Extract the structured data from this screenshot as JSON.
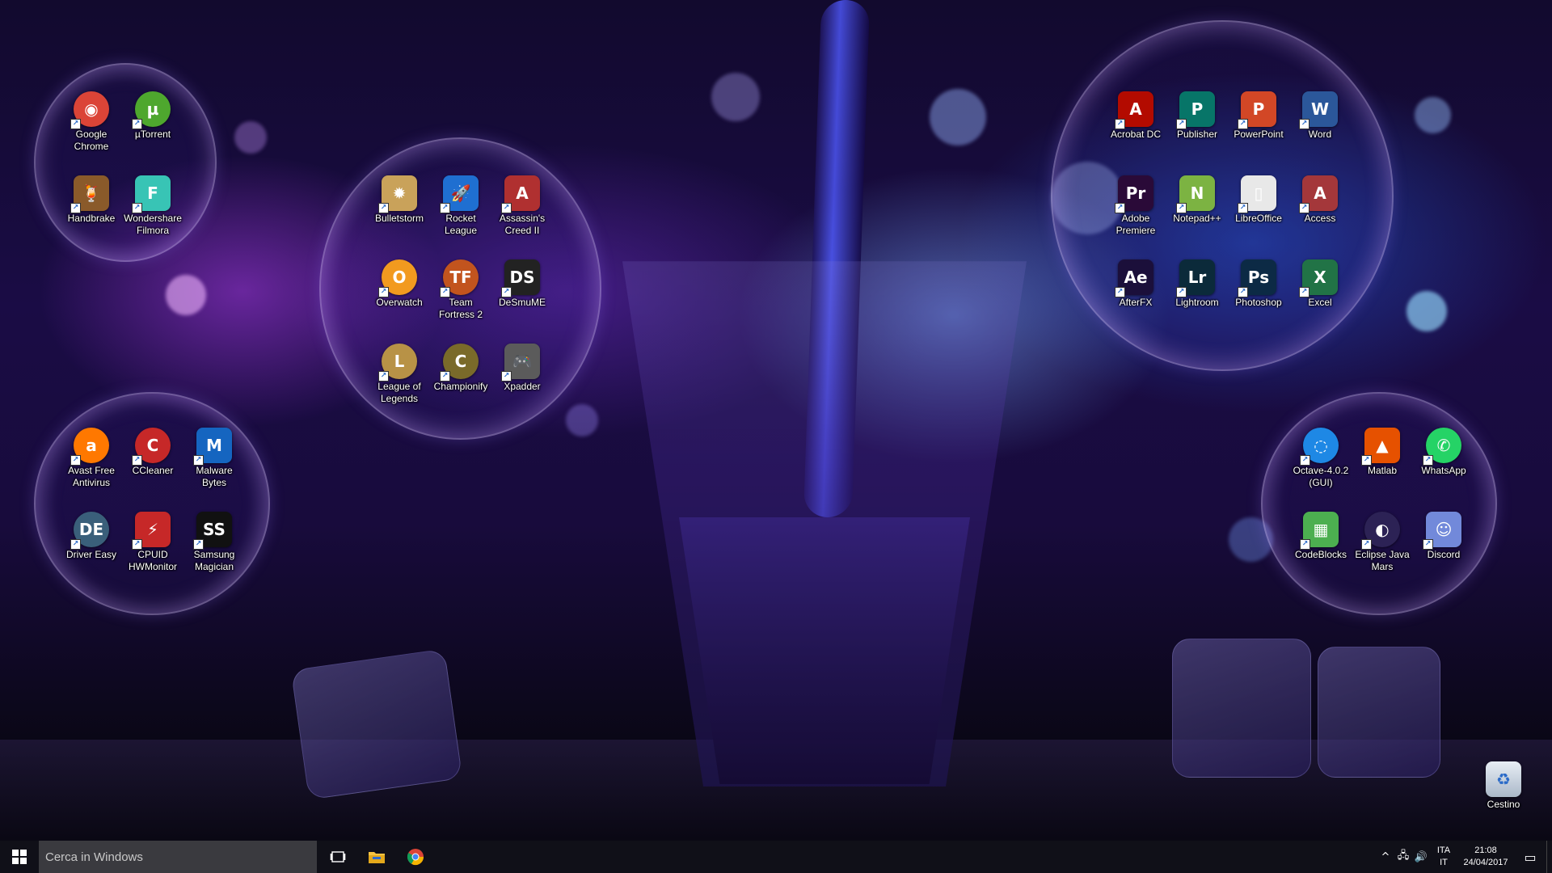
{
  "desktop": {
    "groups": [
      {
        "name": "group-browsers",
        "icons": [
          {
            "label": "Google\nChrome",
            "icon": "chrome-icon",
            "glyph": "◉",
            "color": "#db4437",
            "round": true
          },
          {
            "label": "µTorrent",
            "icon": "utorrent-icon",
            "glyph": "µ",
            "color": "#4ea72e",
            "round": true
          },
          {
            "label": "Handbrake",
            "icon": "handbrake-icon",
            "glyph": "🍹",
            "color": "#8a5a2a",
            "round": false
          },
          {
            "label": "Wondershare\nFilmora",
            "icon": "filmora-icon",
            "glyph": "F",
            "color": "#38c4b5",
            "round": false
          }
        ]
      },
      {
        "name": "group-games",
        "icons": [
          {
            "label": "Bulletstorm",
            "icon": "bulletstorm-icon",
            "glyph": "✹",
            "color": "#c9a25a",
            "round": false
          },
          {
            "label": "Rocket\nLeague",
            "icon": "rocket-league-icon",
            "glyph": "🚀",
            "color": "#1f6fd1",
            "round": false
          },
          {
            "label": "Assassin's\nCreed II",
            "icon": "assassins-creed-icon",
            "glyph": "A",
            "color": "#b03030",
            "round": false
          },
          {
            "label": "Overwatch",
            "icon": "overwatch-icon",
            "glyph": "O",
            "color": "#f29a1f",
            "round": true
          },
          {
            "label": "Team\nFortress 2",
            "icon": "tf2-icon",
            "glyph": "TF",
            "color": "#c2541e",
            "round": true
          },
          {
            "label": "DeSmuME",
            "icon": "desmume-icon",
            "glyph": "DS",
            "color": "#222222",
            "round": false
          },
          {
            "label": "League of\nLegends",
            "icon": "league-of-legends-icon",
            "glyph": "L",
            "color": "#b89246",
            "round": true
          },
          {
            "label": "Championify",
            "icon": "championify-icon",
            "glyph": "C",
            "color": "#7a6a2a",
            "round": true
          },
          {
            "label": "Xpadder",
            "icon": "xpadder-icon",
            "glyph": "🎮",
            "color": "#5b5b5b",
            "round": false
          }
        ]
      },
      {
        "name": "group-office",
        "icons": [
          {
            "label": "Acrobat DC",
            "icon": "acrobat-icon",
            "glyph": "A",
            "color": "#b30b00",
            "round": false
          },
          {
            "label": "Publisher",
            "icon": "publisher-icon",
            "glyph": "P",
            "color": "#077568",
            "round": false
          },
          {
            "label": "PowerPoint",
            "icon": "powerpoint-icon",
            "glyph": "P",
            "color": "#d24726",
            "round": false
          },
          {
            "label": "Word",
            "icon": "word-icon",
            "glyph": "W",
            "color": "#2b579a",
            "round": false
          },
          {
            "label": "Adobe\nPremiere",
            "icon": "premiere-icon",
            "glyph": "Pr",
            "color": "#2a0a38",
            "round": false
          },
          {
            "label": "Notepad++",
            "icon": "notepad-plus-plus-icon",
            "glyph": "N",
            "color": "#7cb342",
            "round": false
          },
          {
            "label": "LibreOffice",
            "icon": "libreoffice-icon",
            "glyph": "▯",
            "color": "#e8e8e8",
            "round": false
          },
          {
            "label": "Access",
            "icon": "access-icon",
            "glyph": "A",
            "color": "#a4373a",
            "round": false
          },
          {
            "label": "AfterFX",
            "icon": "aftereffects-icon",
            "glyph": "Ae",
            "color": "#1b0f3a",
            "round": false
          },
          {
            "label": "Lightroom",
            "icon": "lightroom-icon",
            "glyph": "Lr",
            "color": "#0b2a3a",
            "round": false
          },
          {
            "label": "Photoshop",
            "icon": "photoshop-icon",
            "glyph": "Ps",
            "color": "#0c2a45",
            "round": false
          },
          {
            "label": "Excel",
            "icon": "excel-icon",
            "glyph": "X",
            "color": "#217346",
            "round": false
          }
        ]
      },
      {
        "name": "group-utilities",
        "icons": [
          {
            "label": "Avast Free\nAntivirus",
            "icon": "avast-icon",
            "glyph": "a",
            "color": "#ff7800",
            "round": true
          },
          {
            "label": "CCleaner",
            "icon": "ccleaner-icon",
            "glyph": "C",
            "color": "#c62828",
            "round": true
          },
          {
            "label": "Malware\nBytes",
            "icon": "malwarebytes-icon",
            "glyph": "M",
            "color": "#1565c0",
            "round": false
          },
          {
            "label": "Driver Easy",
            "icon": "driver-easy-icon",
            "glyph": "DE",
            "color": "#3a5f7a",
            "round": true
          },
          {
            "label": "CPUID\nHWMonitor",
            "icon": "hwmonitor-icon",
            "glyph": "⚡",
            "color": "#c62828",
            "round": false
          },
          {
            "label": "Samsung\nMagician",
            "icon": "samsung-magician-icon",
            "glyph": "SS",
            "color": "#111111",
            "round": false
          }
        ]
      },
      {
        "name": "group-dev",
        "icons": [
          {
            "label": "Octave-4.0.2\n(GUI)",
            "icon": "octave-icon",
            "glyph": "◌",
            "color": "#1e88e5",
            "round": true
          },
          {
            "label": "Matlab",
            "icon": "matlab-icon",
            "glyph": "▲",
            "color": "#e65100",
            "round": false
          },
          {
            "label": "WhatsApp",
            "icon": "whatsapp-icon",
            "glyph": "✆",
            "color": "#25d366",
            "round": true
          },
          {
            "label": "CodeBlocks",
            "icon": "codeblocks-icon",
            "glyph": "▦",
            "color": "#4caf50",
            "round": false
          },
          {
            "label": "Eclipse Java\nMars",
            "icon": "eclipse-icon",
            "glyph": "◐",
            "color": "#2c2255",
            "round": true
          },
          {
            "label": "Discord",
            "icon": "discord-icon",
            "glyph": "☺",
            "color": "#7289da",
            "round": false
          }
        ]
      }
    ],
    "recycle_bin": {
      "label": "Cestino",
      "icon": "recycle-bin-icon"
    }
  },
  "taskbar": {
    "start_icon": "windows-logo-icon",
    "search_placeholder": "Cerca in Windows",
    "task_view_icon": "task-view-icon",
    "pinned": [
      {
        "name": "file-explorer-icon",
        "glyph": "▬",
        "color": "#f6c342"
      },
      {
        "name": "chrome-icon",
        "glyph": "◉",
        "color": "#db4437"
      }
    ],
    "tray": {
      "chevron": "^",
      "network_icon": "network-icon",
      "volume_icon": "volume-icon",
      "lang_line1": "ITA",
      "lang_line2": "IT",
      "time": "21:08",
      "date": "24/04/2017",
      "notification_icon": "action-center-icon"
    }
  },
  "colors": {
    "taskbar_bg": "#101018",
    "search_bg": "#3a3a3f",
    "wallpaper_primary": "#1a0c45"
  }
}
